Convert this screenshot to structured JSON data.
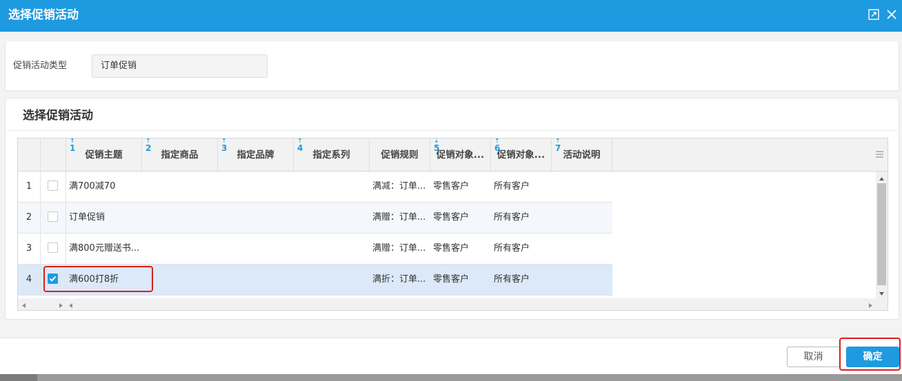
{
  "dialog": {
    "title": "选择促销活动",
    "maximize_icon": "maximize-icon",
    "close_icon": "close-icon"
  },
  "promo_type": {
    "label": "促销活动类型",
    "value": "订单促销"
  },
  "section": {
    "title": "选择促销活动"
  },
  "grid": {
    "columns": [
      {
        "label": "促销主题",
        "sort_index": "1"
      },
      {
        "label": "指定商品",
        "sort_index": "2"
      },
      {
        "label": "指定品牌",
        "sort_index": "3"
      },
      {
        "label": "指定系列",
        "sort_index": "4"
      },
      {
        "label": "促销规则",
        "sort_index": ""
      },
      {
        "label": "促销对象...",
        "sort_index": "5"
      },
      {
        "label": "促销对象...",
        "sort_index": "6"
      },
      {
        "label": "活动说明",
        "sort_index": "7"
      }
    ],
    "rows": [
      {
        "num": "1",
        "checked": false,
        "theme": "满700减70",
        "rule": "满减：订单...",
        "object1": "零售客户",
        "object2": "所有客户"
      },
      {
        "num": "2",
        "checked": false,
        "theme": "订单促销",
        "rule": "满赠：订单...",
        "object1": "零售客户",
        "object2": "所有客户"
      },
      {
        "num": "3",
        "checked": false,
        "theme": "满800元赠送书...",
        "rule": "满赠：订单...",
        "object1": "零售客户",
        "object2": "所有客户"
      },
      {
        "num": "4",
        "checked": true,
        "theme": "满600打8折",
        "rule": "满折：订单...",
        "object1": "零售客户",
        "object2": "所有客户"
      }
    ]
  },
  "footer": {
    "cancel_label": "取消",
    "ok_label": "确定"
  },
  "colors": {
    "accent": "#1e9ae0",
    "highlight_border": "#e01b1b",
    "selected_row": "#dbe9f8"
  }
}
